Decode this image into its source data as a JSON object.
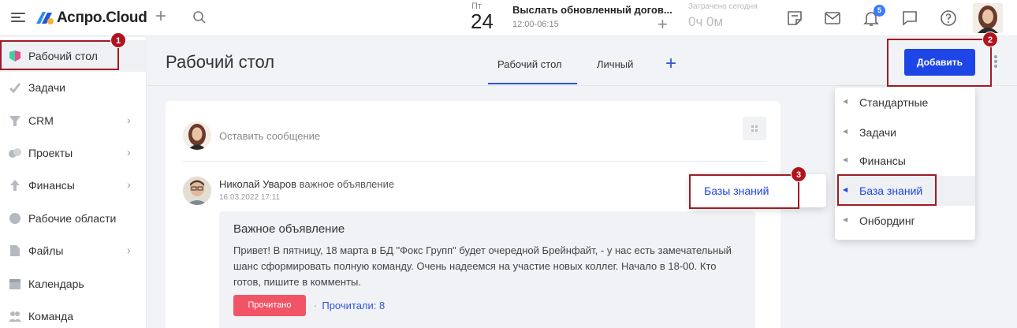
{
  "header": {
    "logo": "Аспро.Cloud",
    "date": {
      "dow": "Пт",
      "day": "24"
    },
    "task": {
      "title": "Выслать обновленный догов...",
      "time": "12:00-06:15"
    },
    "spent": {
      "label": "Затрачено сегодня",
      "value": "0ч 0м"
    },
    "notifications_count": "5",
    "icons": [
      "menu-icon",
      "plus-icon",
      "search-icon",
      "notes-icon",
      "mail-icon",
      "bell-icon",
      "chat-icon",
      "help-icon"
    ]
  },
  "sidebar": {
    "items": [
      {
        "label": "Рабочий стол",
        "active": true
      },
      {
        "label": "Задачи"
      },
      {
        "label": "CRM",
        "submenu": true
      },
      {
        "label": "Проекты",
        "submenu": true
      },
      {
        "label": "Финансы",
        "submenu": true
      },
      {
        "label": "Рабочие области"
      },
      {
        "label": "Файлы",
        "submenu": true
      },
      {
        "label": "Календарь"
      },
      {
        "label": "Команда"
      }
    ]
  },
  "main": {
    "title": "Рабочий стол",
    "tabs": [
      {
        "label": "Рабочий стол",
        "active": true
      },
      {
        "label": "Личный"
      }
    ],
    "add_button": "Добавить",
    "message_placeholder": "Оставить сообщение",
    "post": {
      "author": "Николай Уваров",
      "action": "важное объявление",
      "date": "16.03.2022 17:11",
      "title": "Важное объявление",
      "text": "Привет! В пятницу, 18 марта в БД \"Фокс Групп\" будет очередной Брейнфайт, - у нас есть замечательный шанс сформировать полную команду. Очень надеемся на участие новых коллег. Начало в 18-00. Кто готов, пишите в комменты.",
      "read_button": "Прочитано",
      "read_count": "Прочитали: 8"
    }
  },
  "dropdown": {
    "items": [
      {
        "label": "Стандартные"
      },
      {
        "label": "Задачи"
      },
      {
        "label": "Финансы"
      },
      {
        "label": "База знаний",
        "active": true
      },
      {
        "label": "Онбординг"
      }
    ],
    "submenu_item": "Базы знаний"
  },
  "callouts": [
    "1",
    "2",
    "3"
  ],
  "colors": {
    "accent": "#1e45e6",
    "read_button": "#f25467",
    "callout": "#a01c24"
  }
}
